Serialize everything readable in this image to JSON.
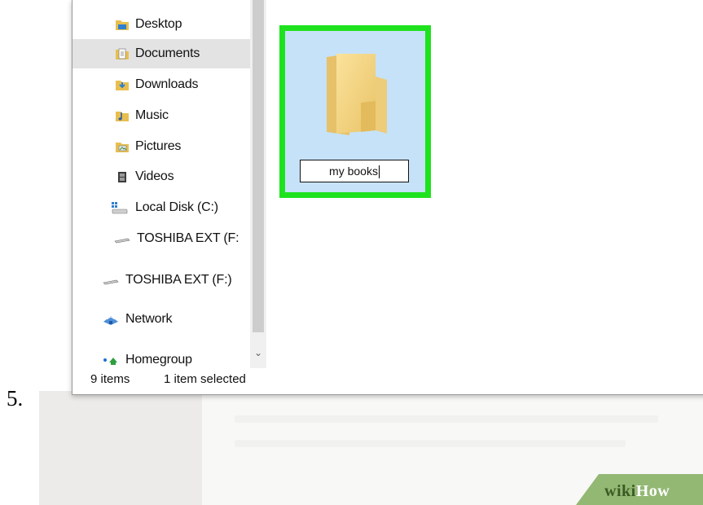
{
  "step": {
    "number": "5."
  },
  "sidebar": {
    "items": [
      {
        "label": "Desktop",
        "icon": "desktop-folder-icon",
        "selected": false
      },
      {
        "label": "Documents",
        "icon": "documents-folder-icon",
        "selected": true
      },
      {
        "label": "Downloads",
        "icon": "downloads-folder-icon",
        "selected": false
      },
      {
        "label": "Music",
        "icon": "music-folder-icon",
        "selected": false
      },
      {
        "label": "Pictures",
        "icon": "pictures-folder-icon",
        "selected": false
      },
      {
        "label": "Videos",
        "icon": "videos-folder-icon",
        "selected": false
      },
      {
        "label": "Local Disk (C:)",
        "icon": "local-disk-icon",
        "selected": false
      },
      {
        "label": "TOSHIBA EXT (F:",
        "icon": "external-drive-icon",
        "selected": false
      },
      {
        "label": "TOSHIBA EXT (F:)",
        "icon": "external-drive-icon",
        "selected": false
      },
      {
        "label": "Network",
        "icon": "network-icon",
        "selected": false
      },
      {
        "label": "Homegroup",
        "icon": "homegroup-icon",
        "selected": false
      }
    ]
  },
  "status_bar": {
    "item_count": "9 items",
    "selection": "1 item selected"
  },
  "content": {
    "new_folder": {
      "name": "my books",
      "icon": "folder-icon",
      "highlight_color": "#1ee21e"
    }
  },
  "watermark": {
    "wiki": "wiki",
    "how": "How"
  },
  "colors": {
    "selection_background": "#c6e2f8",
    "highlight_border": "#1ee21e",
    "sidebar_selected": "#e3e3e3"
  }
}
